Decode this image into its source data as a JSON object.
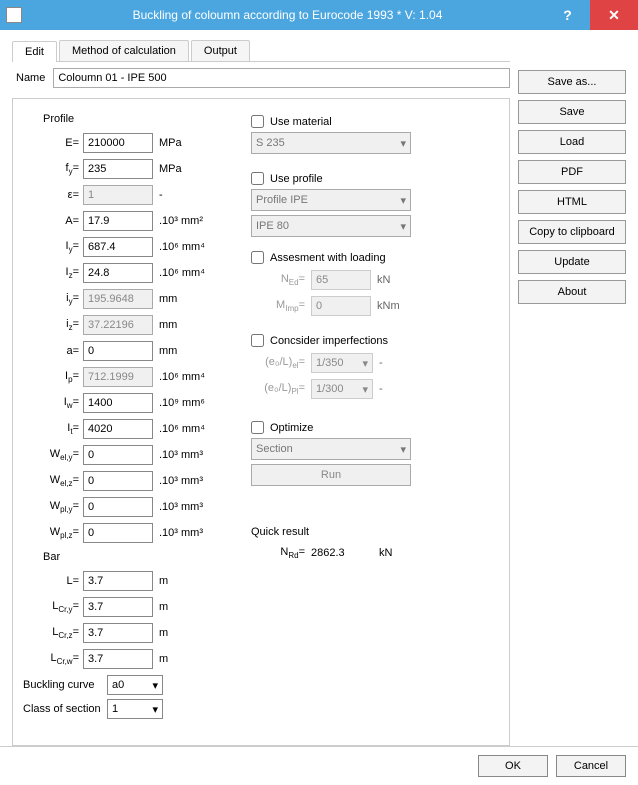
{
  "window": {
    "title": "Buckling of coloumn according to Eurocode 1993 * V: 1.04"
  },
  "tabs": {
    "edit": "Edit",
    "method": "Method of calculation",
    "output": "Output"
  },
  "name_label": "Name",
  "name_value": "Coloumn 01 - IPE 500",
  "profile": {
    "title": "Profile",
    "E": {
      "label": "E=",
      "value": "210000",
      "unit": "MPa"
    },
    "fy": {
      "label": "f",
      "sub": "y",
      "suffix": "=",
      "value": "235",
      "unit": "MPa"
    },
    "eps": {
      "label": "ε=",
      "value": "1",
      "unit": "-"
    },
    "A": {
      "label": "A=",
      "value": "17.9",
      "unit": ".10³ mm²"
    },
    "Iy": {
      "label": "I",
      "sub": "y",
      "suffix": "=",
      "value": "687.4",
      "unit": ".10⁶ mm⁴"
    },
    "Iz": {
      "label": "I",
      "sub": "z",
      "suffix": "=",
      "value": "24.8",
      "unit": ".10⁶ mm⁴"
    },
    "iy": {
      "label": "i",
      "sub": "y",
      "suffix": "=",
      "value": "195.9648",
      "unit": "mm"
    },
    "iz": {
      "label": "i",
      "sub": "z",
      "suffix": "=",
      "value": "37.22196",
      "unit": "mm"
    },
    "a": {
      "label": "a=",
      "value": "0",
      "unit": "mm"
    },
    "Ip": {
      "label": "I",
      "sub": "p",
      "suffix": "=",
      "value": "712.1999",
      "unit": ".10⁶ mm⁴"
    },
    "Iw": {
      "label": "I",
      "sub": "w",
      "suffix": "=",
      "value": "1400",
      "unit": ".10⁹ mm⁶"
    },
    "It": {
      "label": "I",
      "sub": "t",
      "suffix": "=",
      "value": "4020",
      "unit": ".10⁶ mm⁴"
    },
    "Wely": {
      "label": "W",
      "sub": "el,y",
      "suffix": "=",
      "value": "0",
      "unit": ".10³ mm³"
    },
    "Welz": {
      "label": "W",
      "sub": "el,z",
      "suffix": "=",
      "value": "0",
      "unit": ".10³ mm³"
    },
    "Wply": {
      "label": "W",
      "sub": "pl,y",
      "suffix": "=",
      "value": "0",
      "unit": ".10³ mm³"
    },
    "Wplz": {
      "label": "W",
      "sub": "pl,z",
      "suffix": "=",
      "value": "0",
      "unit": ".10³ mm³"
    }
  },
  "bar": {
    "title": "Bar",
    "L": {
      "label": "L=",
      "value": "3.7",
      "unit": "m"
    },
    "Lcry": {
      "label": "L",
      "sub": "Cr,y",
      "suffix": "=",
      "value": "3.7",
      "unit": "m"
    },
    "Lcrz": {
      "label": "L",
      "sub": "Cr,z",
      "suffix": "=",
      "value": "3.7",
      "unit": "m"
    },
    "Lcrw": {
      "label": "L",
      "sub": "Cr,w",
      "suffix": "=",
      "value": "3.7",
      "unit": "m"
    }
  },
  "buckling_curve": {
    "label": "Buckling curve",
    "value": "a0"
  },
  "class_of_section": {
    "label": "Class of section",
    "value": "1"
  },
  "use_material": {
    "label": "Use material",
    "combo": "S 235"
  },
  "use_profile": {
    "label": "Use profile",
    "combo1": "Profile IPE",
    "combo2": "IPE 80"
  },
  "assessment": {
    "label": "Assesment with loading",
    "NEd": {
      "label": "N",
      "sub": "Ed",
      "suffix": "=",
      "value": "65",
      "unit": "kN"
    },
    "MImp": {
      "label": "M",
      "sub": "Imp",
      "suffix": "=",
      "value": "0",
      "unit": "kNm"
    }
  },
  "imperfections": {
    "label": "Concsider imperfections",
    "e0Lel": {
      "label": "(e₀/L)",
      "sub": "el",
      "suffix": "=",
      "value": "1/350",
      "unit": "-"
    },
    "e0Lpl": {
      "label": "(e₀/L)",
      "sub": "Pl",
      "suffix": "=",
      "value": "1/300",
      "unit": "-"
    }
  },
  "optimize": {
    "label": "Optimize",
    "combo": "Section",
    "run": "Run"
  },
  "quick_result": {
    "title": "Quick result",
    "NRd": {
      "label": "N",
      "sub": "Rd",
      "suffix": "=",
      "value": "2862.3",
      "unit": "kN"
    }
  },
  "side": {
    "save_as": "Save as...",
    "save": "Save",
    "load": "Load",
    "pdf": "PDF",
    "html": "HTML",
    "copy": "Copy to clipboard",
    "update": "Update",
    "about": "About"
  },
  "footer": {
    "ok": "OK",
    "cancel": "Cancel"
  },
  "help": "?"
}
